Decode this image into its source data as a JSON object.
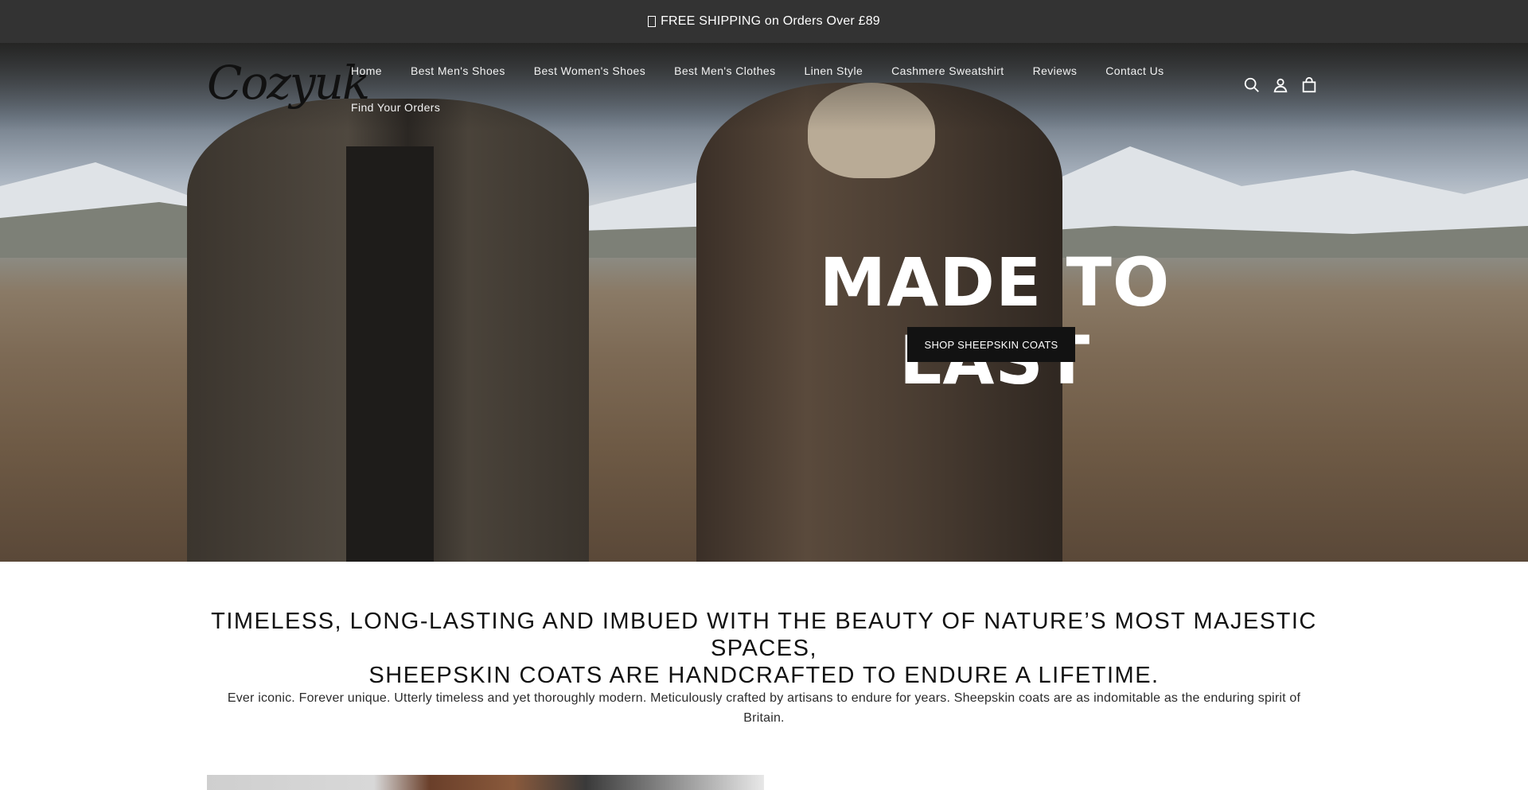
{
  "announcement": {
    "text": "FREE SHIPPING on Orders Over £89"
  },
  "header": {
    "logo_text": "Cozyuk",
    "nav_row1": [
      "Home",
      "Best Men's Shoes",
      "Best Women's Shoes",
      "Best Men's Clothes",
      "Linen Style",
      "Cashmere Sweatshirt",
      "Reviews",
      "Contact Us"
    ],
    "nav_row2": [
      "Find Your Orders"
    ],
    "icons": [
      "search-icon",
      "account-icon",
      "cart-icon"
    ]
  },
  "hero": {
    "title": "MADE TO LAST",
    "button_label": "SHOP SHEEPSKIN COATS"
  },
  "intro": {
    "heading_line1": "TIMELESS, LONG-LASTING AND IMBUED WITH THE BEAUTY OF NATURE’S MOST MAJESTIC SPACES,",
    "heading_line2": "SHEEPSKIN COATS ARE HANDCRAFTED TO ENDURE A LIFETIME.",
    "body": "Ever iconic. Forever unique. Utterly timeless and yet thoroughly modern. Meticulously crafted by artisans to endure for years. Sheepskin coats are as indomitable as the enduring spirit of Britain."
  },
  "colors": {
    "announcement_bg": "#333333",
    "button_bg": "#121212",
    "text": "#121212"
  }
}
